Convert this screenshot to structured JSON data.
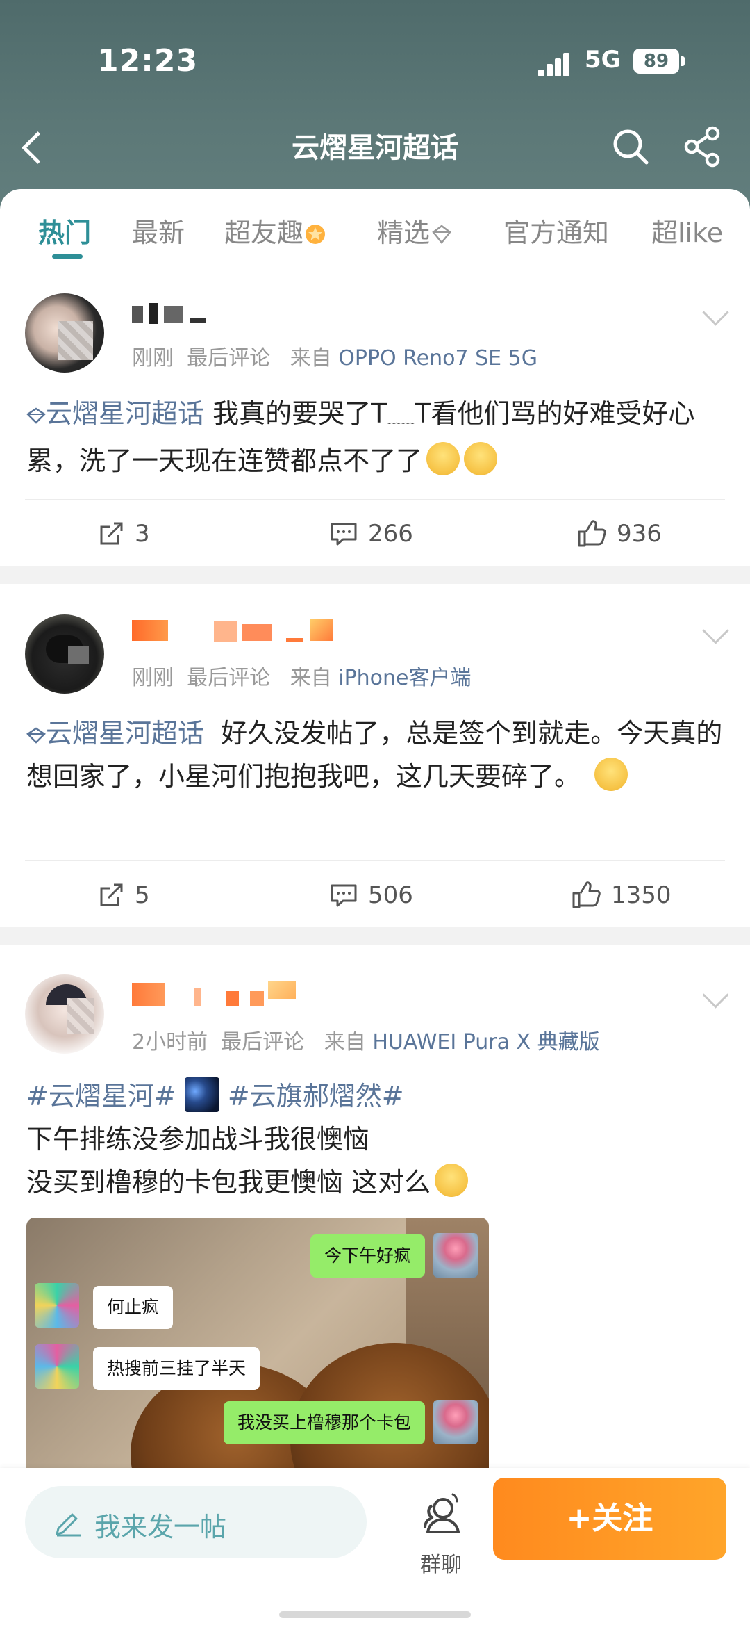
{
  "status": {
    "time": "12:23",
    "network": "5G",
    "battery": "89"
  },
  "header": {
    "title": "云熠星河超话"
  },
  "tabs": [
    {
      "label": "热门"
    },
    {
      "label": "最新"
    },
    {
      "label": "超友趣"
    },
    {
      "label": "精选"
    },
    {
      "label": "官方通知"
    },
    {
      "label": "超like"
    }
  ],
  "posts": [
    {
      "time": "刚刚",
      "last_comment": "最后评论",
      "from": "来自",
      "device": "OPPO Reno7 SE 5G",
      "topic": "云熠星河超话",
      "text": "我真的要哭了T",
      "text2": "T看他们骂的好难受好心累，洗了一天现在连赞都点不了了",
      "shares": "3",
      "comments": "266",
      "likes": "936"
    },
    {
      "time": "刚刚",
      "last_comment": "最后评论",
      "from": "来自",
      "device": "iPhone客户端",
      "topic": "云熠星河超话",
      "text": "好久没发帖了，总是签个到就走。今天真的想回家了，小星河们抱抱我吧，这几天要碎了。",
      "shares": "5",
      "comments": "506",
      "likes": "1350"
    },
    {
      "time": "2小时前",
      "last_comment": "最后评论",
      "from": "来自",
      "device": "HUAWEI Pura X 典藏版",
      "tag1": "#云熠星河#",
      "tag2": "#云旗郝熠然#",
      "line1": "下午排练没参加战斗我很懊恼",
      "line2": "没买到橹穆的卡包我更懊恼 这对么",
      "chat": {
        "msg1": "今下午好疯",
        "msg2": "何止疯",
        "msg3": "热搜前三挂了半天",
        "msg4": "我没买上橹穆那个卡包"
      }
    }
  ],
  "bottom": {
    "composer_placeholder": "我来发一帖",
    "group_chat": "群聊",
    "follow": "+关注"
  },
  "colors": {
    "header": "#5a7675",
    "accent": "#2e8f97",
    "topic": "#5a7599",
    "follow": "#ff9a24"
  }
}
